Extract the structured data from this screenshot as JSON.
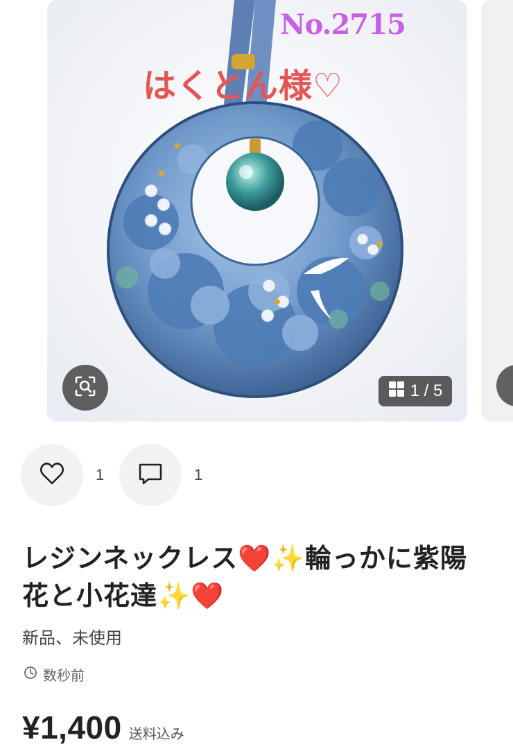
{
  "gallery": {
    "overlay_number": "No.2715",
    "overlay_name": "はくとん様♡",
    "counter": "1 / 5",
    "icons": {
      "lens": "image-search-icon",
      "grid": "grid-icon"
    }
  },
  "actions": {
    "like_count": "1",
    "comment_count": "1",
    "icons": {
      "like": "heart-icon",
      "comment": "comment-icon"
    }
  },
  "item": {
    "title": "レジンネックレス❤️✨輪っかに紫陽花と小花達✨❤️",
    "condition": "新品、未使用",
    "posted": "数秒前",
    "price": "¥1,400",
    "shipping": "送料込み"
  },
  "colors": {
    "overlay_number": "#c860e6",
    "overlay_name": "#e25656",
    "pendant_blue": "#5b85b8",
    "button_dark": "#5e5e5e"
  }
}
